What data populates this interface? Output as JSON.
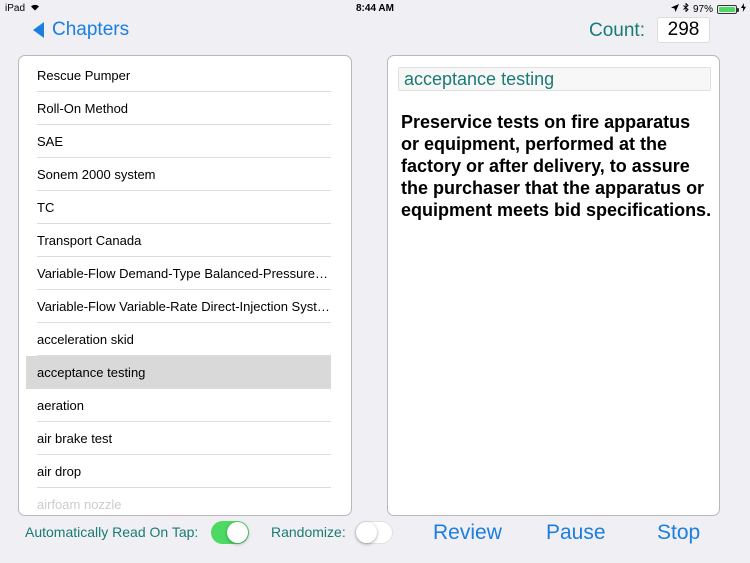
{
  "status_bar": {
    "device": "iPad",
    "time": "8:44 AM",
    "battery": "97%",
    "battery_level": 0.97
  },
  "nav": {
    "back_label": "Chapters",
    "count_label": "Count:",
    "count_value": "298"
  },
  "list": {
    "items": [
      "Rescue Pumper",
      "Roll-On Method",
      "SAE",
      "Sonem 2000 system",
      "TC",
      "Transport Canada",
      "Variable-Flow Demand-Type Balanced-Pressure…",
      "Variable-Flow Variable-Rate Direct-Injection Syst…",
      "acceleration skid",
      "acceptance testing",
      "aeration",
      "air brake test",
      "air drop",
      "airfoam nozzle"
    ],
    "selected_index": 9
  },
  "detail": {
    "term": "acceptance testing",
    "definition": "Preservice tests on fire apparatus or equipment, performed at the factory or after delivery, to assure the purchaser that the apparatus or equipment meets bid specifications."
  },
  "controls": {
    "auto_read_label": "Automatically Read On Tap:",
    "auto_read_on": true,
    "randomize_label": "Randomize:",
    "randomize_on": false,
    "review_label": "Review",
    "pause_label": "Pause",
    "stop_label": "Stop"
  },
  "colors": {
    "accent_blue": "#1c7ee0",
    "teal_text": "#1a7b73",
    "toggle_green": "#4cd964",
    "selected_row": "#d9d9d9"
  }
}
